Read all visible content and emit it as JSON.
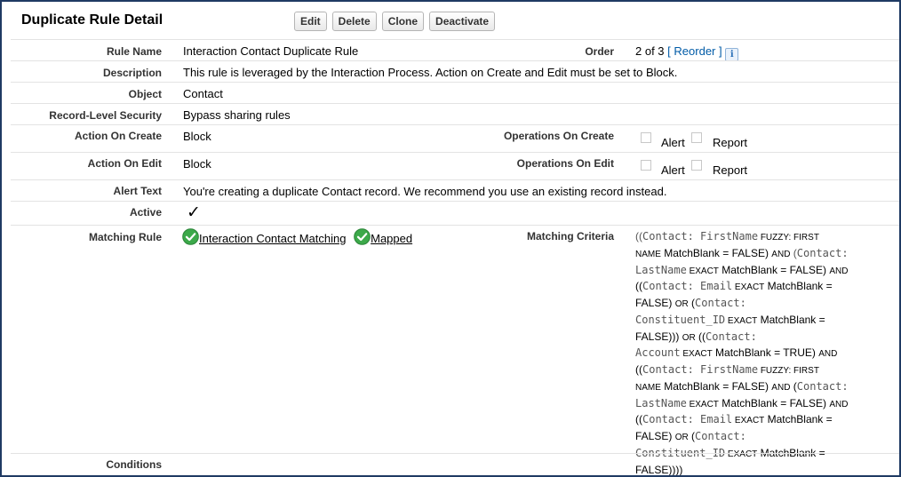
{
  "page": {
    "title": "Duplicate Rule Detail"
  },
  "buttons": {
    "edit": "Edit",
    "delete": "Delete",
    "clone": "Clone",
    "deactivate": "Deactivate"
  },
  "fields": {
    "rule_name": {
      "label": "Rule Name",
      "value": "Interaction Contact Duplicate Rule"
    },
    "order": {
      "label": "Order",
      "value": "2 of 3",
      "bracket_open": "[",
      "link": "Reorder",
      "bracket_close": "]",
      "info_icon": "i"
    },
    "description": {
      "label": "Description",
      "value": "This rule is leveraged by the Interaction Process. Action on Create and Edit must be set to Block."
    },
    "object": {
      "label": "Object",
      "value": "Contact"
    },
    "record_security": {
      "label": "Record-Level Security",
      "value": "Bypass sharing rules"
    },
    "action_on_create": {
      "label": "Action On Create",
      "value": "Block"
    },
    "operations_on_create": {
      "label": "Operations On Create",
      "alert": "Alert",
      "report": "Report",
      "alert_checked": false,
      "report_checked": false
    },
    "action_on_edit": {
      "label": "Action On Edit",
      "value": "Block"
    },
    "operations_on_edit": {
      "label": "Operations On Edit",
      "alert": "Alert",
      "report": "Report",
      "alert_checked": false,
      "report_checked": false
    },
    "alert_text": {
      "label": "Alert Text",
      "value": "You're creating a duplicate Contact record. We recommend you use an existing record instead."
    },
    "active": {
      "label": "Active",
      "checked": true,
      "checkmark": "✓"
    },
    "matching_rule": {
      "label": "Matching Rule",
      "link": "Interaction Contact Matching",
      "status": "Mapped"
    },
    "matching_criteria": {
      "label": "Matching Criteria",
      "lines": [
        [
          {
            "t": "((",
            "c": "p"
          },
          {
            "t": "Contact: FirstName",
            "c": "mono"
          },
          {
            "t": " FUZZY: FIRST",
            "c": "sm"
          }
        ],
        [
          {
            "t": "NAME",
            "c": "sm"
          },
          {
            "t": " MatchBlank = FALSE) ",
            "c": ""
          },
          {
            "t": "AND",
            "c": "sm"
          },
          {
            "t": " (",
            "c": "p"
          },
          {
            "t": "Contact:",
            "c": "mono"
          }
        ],
        [
          {
            "t": "LastName",
            "c": "mono"
          },
          {
            "t": " EXACT",
            "c": "sm"
          },
          {
            "t": " MatchBlank = FALSE) ",
            "c": ""
          },
          {
            "t": "AND",
            "c": "sm"
          }
        ],
        [
          {
            "t": "((",
            "c": ""
          },
          {
            "t": "Contact: Email",
            "c": "mono"
          },
          {
            "t": " EXACT",
            "c": "sm"
          },
          {
            "t": " MatchBlank =",
            "c": ""
          }
        ],
        [
          {
            "t": "FALSE) ",
            "c": ""
          },
          {
            "t": "OR",
            "c": "sm"
          },
          {
            "t": " (",
            "c": ""
          },
          {
            "t": "Contact:",
            "c": "mono"
          }
        ],
        [
          {
            "t": "Constituent_ID",
            "c": "mono"
          },
          {
            "t": " EXACT",
            "c": "sm"
          },
          {
            "t": " MatchBlank =",
            "c": ""
          }
        ],
        [
          {
            "t": "FALSE))) ",
            "c": ""
          },
          {
            "t": "OR",
            "c": "sm"
          },
          {
            "t": " ((",
            "c": ""
          },
          {
            "t": "Contact:",
            "c": "mono"
          }
        ],
        [
          {
            "t": "Account",
            "c": "mono"
          },
          {
            "t": " EXACT",
            "c": "sm"
          },
          {
            "t": " MatchBlank = TRUE) ",
            "c": ""
          },
          {
            "t": "AND",
            "c": "sm"
          }
        ],
        [
          {
            "t": "((",
            "c": ""
          },
          {
            "t": "Contact: FirstName",
            "c": "mono"
          },
          {
            "t": " FUZZY: FIRST",
            "c": "sm"
          }
        ],
        [
          {
            "t": "NAME",
            "c": "sm"
          },
          {
            "t": " MatchBlank = FALSE) ",
            "c": ""
          },
          {
            "t": "AND",
            "c": "sm"
          },
          {
            "t": " (",
            "c": ""
          },
          {
            "t": "Contact:",
            "c": "mono"
          }
        ],
        [
          {
            "t": "LastName",
            "c": "mono"
          },
          {
            "t": " EXACT",
            "c": "sm"
          },
          {
            "t": " MatchBlank = FALSE) ",
            "c": ""
          },
          {
            "t": "AND",
            "c": "sm"
          }
        ],
        [
          {
            "t": "((",
            "c": ""
          },
          {
            "t": "Contact: Email",
            "c": "mono"
          },
          {
            "t": " EXACT",
            "c": "sm"
          },
          {
            "t": " MatchBlank =",
            "c": ""
          }
        ],
        [
          {
            "t": "FALSE) ",
            "c": ""
          },
          {
            "t": "OR",
            "c": "sm"
          },
          {
            "t": " (",
            "c": ""
          },
          {
            "t": "Contact:",
            "c": "mono"
          }
        ],
        [
          {
            "t": "Constituent_ID",
            "c": "mono"
          },
          {
            "t": " EXACT",
            "c": "sm"
          },
          {
            "t": " MatchBlank =",
            "c": ""
          }
        ],
        [
          {
            "t": "FALSE))))",
            "c": ""
          }
        ]
      ]
    },
    "conditions": {
      "label": "Conditions",
      "value": ""
    }
  },
  "colors": {
    "border": "#1f3a63",
    "link": "#015ba7",
    "ok_green": "#3ca94a",
    "divider": "#e3e3e3"
  },
  "icons": {
    "matching_rule_status": "green-check-circle-icon",
    "info": "info-icon"
  }
}
